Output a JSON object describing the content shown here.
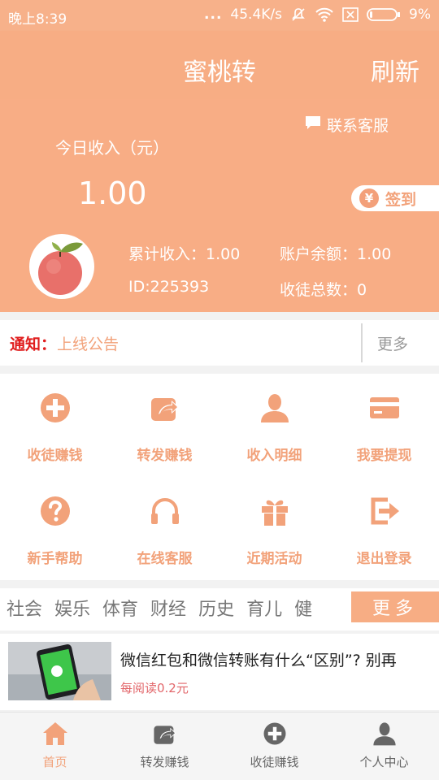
{
  "status_bar": {
    "time": "晚上8:39",
    "dots": "...",
    "speed": "45.4K/s",
    "battery": "9%"
  },
  "header": {
    "title": "蜜桃转",
    "refresh": "刷新"
  },
  "income": {
    "contact_service": "联系客服",
    "today_label": "今日收入（元）",
    "today_value": "1.00",
    "checkin_label": "签到",
    "checkin_symbol": "¥",
    "total_income": "累计收入：1.00",
    "balance": "账户余额：1.00",
    "user_id": "ID:225393",
    "apprentice_total": "收徒总数：0"
  },
  "notice": {
    "label": "通知：",
    "text": "上线公告",
    "more": "更多"
  },
  "grid": [
    {
      "label": "收徒赚钱",
      "icon": "plus-circle-icon"
    },
    {
      "label": "转发赚钱",
      "icon": "share-icon"
    },
    {
      "label": "收入明细",
      "icon": "person-icon"
    },
    {
      "label": "我要提现",
      "icon": "card-icon"
    },
    {
      "label": "新手帮助",
      "icon": "question-icon"
    },
    {
      "label": "在线客服",
      "icon": "headphones-icon"
    },
    {
      "label": "近期活动",
      "icon": "gift-icon"
    },
    {
      "label": "退出登录",
      "icon": "logout-icon"
    }
  ],
  "categories": {
    "items": [
      "社会",
      "娱乐",
      "体育",
      "财经",
      "历史",
      "育儿",
      "健"
    ],
    "more": "更多"
  },
  "article": {
    "title": "微信红包和微信转账有什么“区别”? 别再",
    "read_reward": "每阅读0.2元"
  },
  "tabbar": [
    {
      "label": "首页",
      "active": true
    },
    {
      "label": "转发赚钱",
      "active": false
    },
    {
      "label": "收徒赚钱",
      "active": false
    },
    {
      "label": "个人中心",
      "active": false
    }
  ],
  "colors": {
    "accent": "#f7ad84",
    "accent_text": "#f2a27a",
    "notice_red": "#e01e1e",
    "read_red": "#e2666a"
  }
}
